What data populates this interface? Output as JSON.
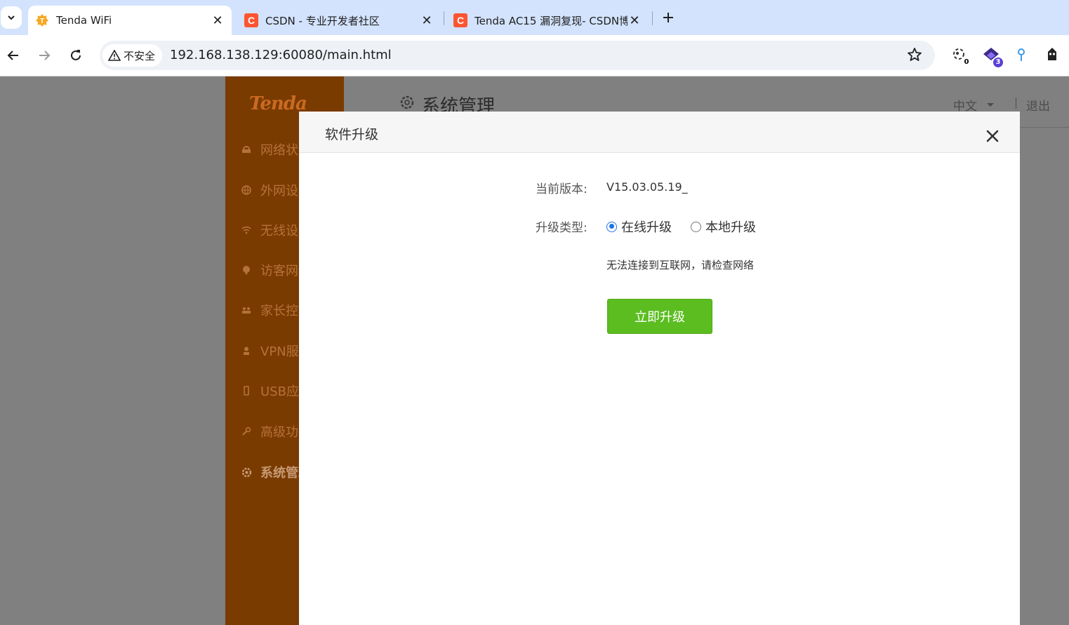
{
  "browser": {
    "tabs": [
      {
        "title": "Tenda WiFi",
        "active": true,
        "favicon": "tenda-favicon-icon"
      },
      {
        "title": "CSDN - 专业开发者社区",
        "active": false,
        "favicon": "csdn-favicon-icon"
      },
      {
        "title": "Tenda AC15 漏洞复现- CSDN博",
        "active": false,
        "favicon": "csdn-favicon-icon"
      }
    ],
    "security_label": "不安全",
    "url": "192.168.138.129:60080/main.html",
    "extensions": [
      {
        "name": "extension-1-icon",
        "badge": "0"
      },
      {
        "name": "extension-2-icon",
        "badge": "3"
      },
      {
        "name": "extension-3-icon",
        "badge": ""
      },
      {
        "name": "extension-4-icon",
        "badge": ""
      }
    ]
  },
  "router": {
    "brand": "Tenda",
    "header_title": "系统管理",
    "language": "中文",
    "logout": "退出",
    "sidebar": [
      {
        "label": "网络状态",
        "icon": "network-status-icon"
      },
      {
        "label": "外网设置",
        "icon": "globe-icon"
      },
      {
        "label": "无线设置",
        "icon": "wifi-icon"
      },
      {
        "label": "访客网络",
        "icon": "guest-icon"
      },
      {
        "label": "家长控制",
        "icon": "parental-icon"
      },
      {
        "label": "VPN服务",
        "icon": "vpn-icon"
      },
      {
        "label": "USB应用",
        "icon": "usb-icon"
      },
      {
        "label": "高级功能",
        "icon": "wrench-icon"
      },
      {
        "label": "系统管理",
        "icon": "gear-icon",
        "active": true
      }
    ]
  },
  "modal": {
    "title": "软件升级",
    "current_version_label": "当前版本:",
    "current_version_value": "V15.03.05.19_",
    "upgrade_type_label": "升级类型:",
    "options": [
      {
        "label": "在线升级",
        "checked": true
      },
      {
        "label": "本地升级",
        "checked": false
      }
    ],
    "hint": "无法连接到互联网，请检查网络",
    "upgrade_button": "立即升级"
  },
  "colors": {
    "sidebar_bg": "#7a3b00",
    "overlay": "#808080",
    "upgrade_button": "#5bbd20",
    "tabbar": "#d3e3fd"
  }
}
